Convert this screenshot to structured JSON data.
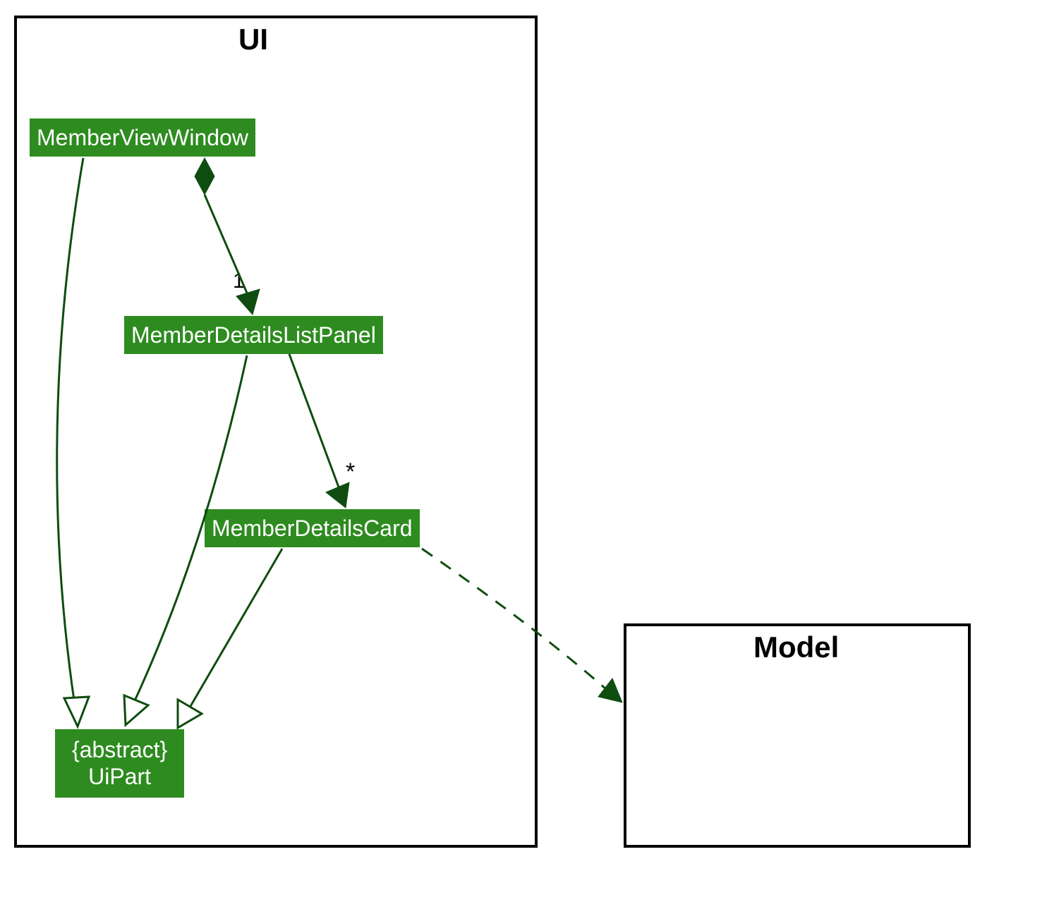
{
  "packages": {
    "ui": {
      "title": "UI"
    },
    "model": {
      "title": "Model"
    }
  },
  "classes": {
    "memberViewWindow": {
      "name": "MemberViewWindow"
    },
    "memberDetailsListPanel": {
      "name": "MemberDetailsListPanel"
    },
    "memberDetailsCard": {
      "name": "MemberDetailsCard"
    },
    "uiPart": {
      "abstract": "{abstract}",
      "name": "UiPart"
    }
  },
  "multiplicities": {
    "one": "1",
    "many": "*"
  }
}
